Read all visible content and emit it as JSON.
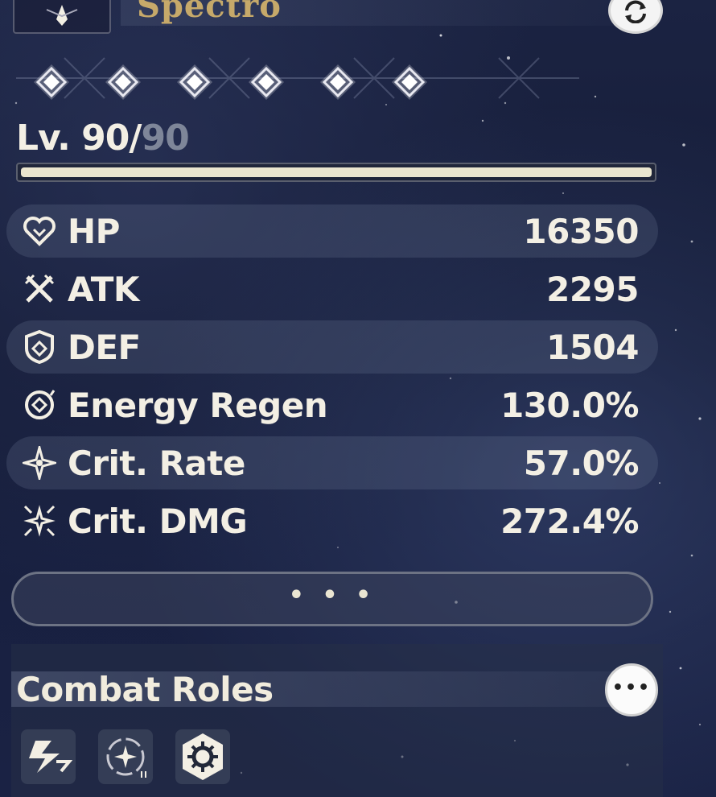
{
  "header": {
    "element_name": "Spectro",
    "emblem_icon": "spectro-emblem-icon",
    "swap_icon": "swap-icon"
  },
  "sequence": {
    "nodes": [
      {
        "icon": "diamond-icon",
        "active": true
      },
      {
        "icon": "diamond-icon",
        "active": true
      },
      {
        "icon": "diamond-icon",
        "active": true
      },
      {
        "icon": "diamond-icon",
        "active": true
      },
      {
        "icon": "diamond-icon",
        "active": true
      },
      {
        "icon": "diamond-icon",
        "active": true
      }
    ]
  },
  "level": {
    "prefix": "Lv. ",
    "current": "90",
    "separator": "/",
    "max": "90",
    "progress": 1.0
  },
  "stats": [
    {
      "icon": "heart-icon",
      "label": "HP",
      "value": "16350"
    },
    {
      "icon": "crossed-swords-icon",
      "label": "ATK",
      "value": "2295"
    },
    {
      "icon": "shield-icon",
      "label": "DEF",
      "value": "1504"
    },
    {
      "icon": "energy-regen-icon",
      "label": "Energy Regen",
      "value": "130.0%"
    },
    {
      "icon": "crit-rate-icon",
      "label": "Crit. Rate",
      "value": "57.0%"
    },
    {
      "icon": "crit-dmg-icon",
      "label": "Crit. DMG",
      "value": "272.4%"
    }
  ],
  "more_button": {
    "label": "• • •"
  },
  "combat_roles": {
    "title": "Combat Roles",
    "more_label": "•••",
    "roles": [
      {
        "icon": "lightning-role-icon"
      },
      {
        "icon": "orbit-star-role-icon"
      },
      {
        "icon": "gear-hexagon-role-icon"
      }
    ]
  },
  "colors": {
    "accent_gold": "#c6a96a",
    "text": "#f3efe4",
    "level_max": "#7e8699"
  }
}
